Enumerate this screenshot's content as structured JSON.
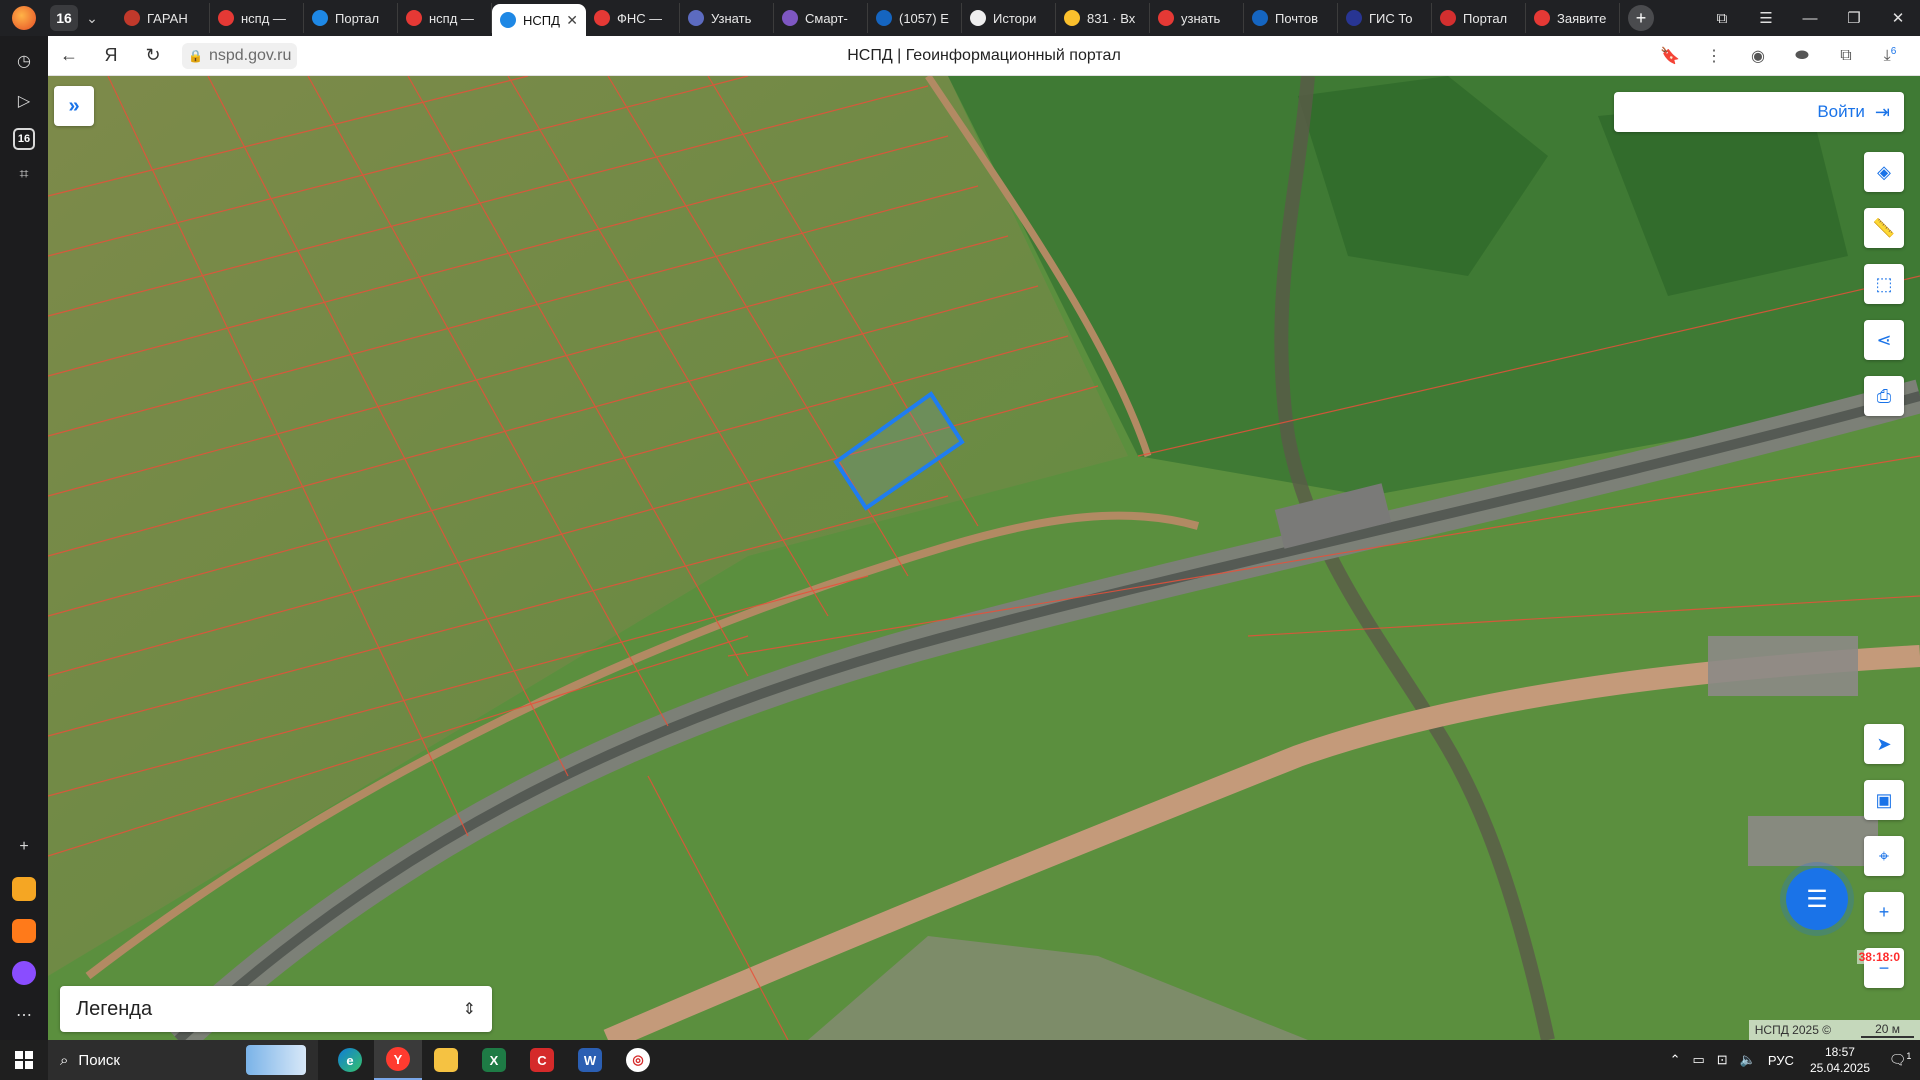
{
  "browser": {
    "tab_count": "16",
    "tabs": [
      {
        "label": "ГАРАН",
        "color": "#c0392b"
      },
      {
        "label": "нспд —",
        "color": "#e53935"
      },
      {
        "label": "Портал",
        "color": "#1e88e5"
      },
      {
        "label": "нспд —",
        "color": "#e53935"
      },
      {
        "label": "НСПД",
        "color": "#1e88e5",
        "active": true
      },
      {
        "label": "ФНС —",
        "color": "#e53935"
      },
      {
        "label": "Узнать",
        "color": "#5c6bc0"
      },
      {
        "label": "Смарт-",
        "color": "#7e57c2"
      },
      {
        "label": "(1057) Е",
        "color": "#1565c0"
      },
      {
        "label": "Истори",
        "color": "#eeeeee"
      },
      {
        "label": "831 · Вх",
        "color": "#fbc02d"
      },
      {
        "label": "узнать",
        "color": "#e53935"
      },
      {
        "label": "Почтов",
        "color": "#1565c0"
      },
      {
        "label": "ГИС То",
        "color": "#283593"
      },
      {
        "label": "Портал",
        "color": "#d32f2f"
      },
      {
        "label": "Заявите",
        "color": "#e53935"
      }
    ],
    "url": "nspd.gov.ru",
    "page_title": "НСПД | Геоинформационный портал",
    "downloads_badge": "6"
  },
  "map": {
    "login_label": "Войти",
    "legend_label": "Легенда",
    "coordinate": "38:18:0",
    "attribution": "НСПД 2025 ©",
    "scale_label": "20 м"
  },
  "taskbar": {
    "search_label": "Поиск",
    "language": "РУС",
    "time": "18:57",
    "date": "25.04.2025",
    "notification_count": "1"
  }
}
